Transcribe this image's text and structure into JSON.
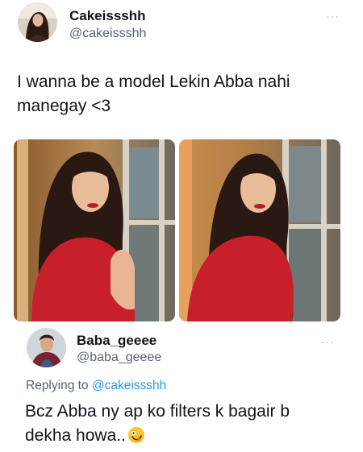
{
  "tweet": {
    "display_name": "Cakeissshh",
    "handle": "@cakeissshh",
    "more_icon": "more-horizontal-icon",
    "text_line1": "I wanna be a model Lekin Abba nahi",
    "text_line2": "manegay <3",
    "photos": [
      {
        "name": "photo-left"
      },
      {
        "name": "photo-right"
      }
    ]
  },
  "reply": {
    "display_name": "Baba_geeee",
    "handle": "@baba_geeee",
    "more_icon": "more-horizontal-icon",
    "replying_prefix": "Replying to",
    "replying_handle": "@cakeissshh",
    "text_line1": "Bcz Abba ny ap ko filters k bagair b",
    "text_line2": "dekha howa..",
    "emoji": "zany-face-emoji"
  },
  "colors": {
    "text": "#0f1419",
    "secondary": "#536471",
    "link": "#1d9bf0",
    "dress": "#c8202a",
    "background": "#ffffff"
  }
}
